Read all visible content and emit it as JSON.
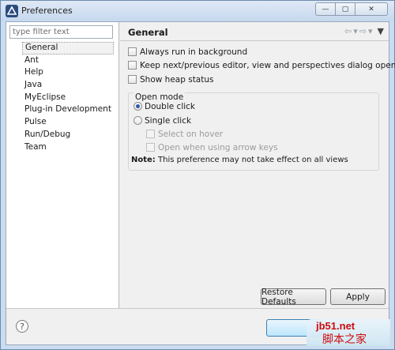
{
  "window": {
    "title": "Preferences",
    "controls": {
      "minimize": "—",
      "restore": "▢",
      "close": "✕"
    }
  },
  "sidebar": {
    "filter_placeholder": "type filter text",
    "items": [
      {
        "label": "General",
        "selected": true
      },
      {
        "label": "Ant"
      },
      {
        "label": "Help"
      },
      {
        "label": "Java"
      },
      {
        "label": "MyEclipse"
      },
      {
        "label": "Plug-in Development"
      },
      {
        "label": "Pulse"
      },
      {
        "label": "Run/Debug"
      },
      {
        "label": "Team"
      }
    ]
  },
  "page": {
    "title": "General",
    "nav": {
      "back": "⇦",
      "back_menu": "▾",
      "forward": "⇨",
      "forward_menu": "▾",
      "view_menu": "▼"
    },
    "options": {
      "run_in_background": {
        "label": "Always run in background",
        "checked": false
      },
      "keep_dialog_open": {
        "label": "Keep next/previous editor, view and perspectives dialog open",
        "checked": false
      },
      "show_heap": {
        "label": "Show heap status",
        "checked": false
      }
    },
    "open_mode": {
      "title": "Open mode",
      "double_click": {
        "label": "Double click",
        "selected": true
      },
      "single_click": {
        "label": "Single click",
        "selected": false
      },
      "select_on_hover": {
        "label": "Select on hover",
        "checked": false,
        "enabled": false
      },
      "open_arrow_keys": {
        "label": "Open when using arrow keys",
        "checked": false,
        "enabled": false
      }
    },
    "note_label": "Note:",
    "note_text": " This preference may not take effect on all views",
    "restore_defaults": "Restore Defaults",
    "apply": "Apply"
  },
  "footer": {
    "help": "?"
  },
  "watermark": {
    "url": "jb51.net",
    "cn": "脚本之家"
  },
  "colors": {
    "titlebar": "#c6d8ee",
    "radio_dot": "#2b5aa7",
    "watermark_text": "#cc0000"
  }
}
